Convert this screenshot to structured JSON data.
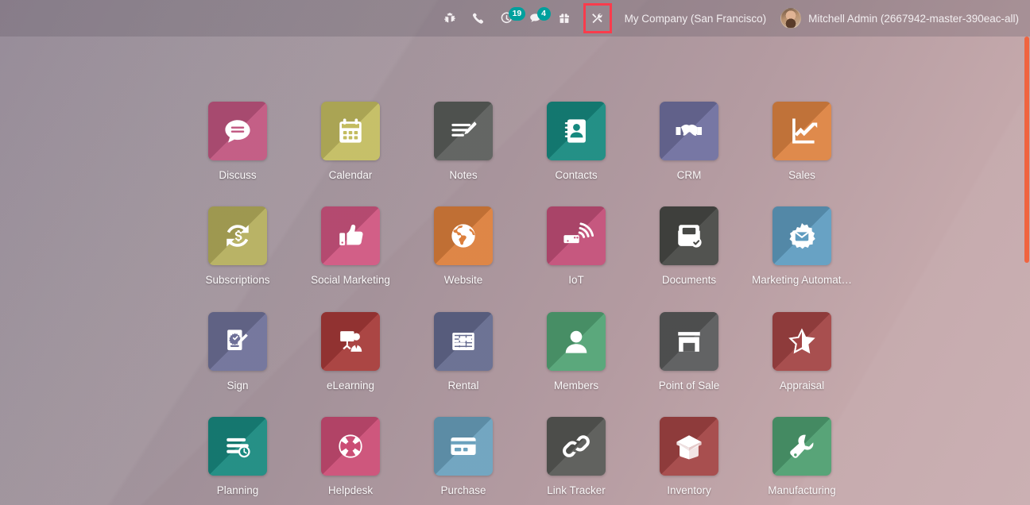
{
  "topbar": {
    "icons": [
      {
        "name": "bug-icon",
        "label": "Bug",
        "badge": null
      },
      {
        "name": "phone-icon",
        "label": "Phone",
        "badge": null
      },
      {
        "name": "activity-clock-icon",
        "label": "Activities",
        "badge": "19"
      },
      {
        "name": "messages-icon",
        "label": "Messages",
        "badge": "4"
      },
      {
        "name": "gift-icon",
        "label": "Gift",
        "badge": null
      },
      {
        "name": "tools-icon",
        "label": "Tools",
        "badge": null,
        "highlighted": true
      }
    ],
    "company": "My Company (San Francisco)",
    "user": "Mitchell Admin (2667942-master-390eac-all)",
    "avatar_name": "avatar",
    "badge_color": "#00a09d",
    "highlight_color": "#fa3c4c"
  },
  "apps": [
    {
      "label": "Discuss",
      "icon": "discuss-icon",
      "color": "#c0557f"
    },
    {
      "label": "Calendar",
      "icon": "calendar-icon",
      "color": "#c3bc60"
    },
    {
      "label": "Notes",
      "icon": "notes-icon",
      "color": "#5a5d5a"
    },
    {
      "label": "Contacts",
      "icon": "contacts-icon",
      "color": "#16897f"
    },
    {
      "label": "CRM",
      "icon": "crm-handshake-icon",
      "color": "#6f6f9e"
    },
    {
      "label": "Sales",
      "icon": "sales-chart-icon",
      "color": "#dd8341"
    },
    {
      "label": "Subscriptions",
      "icon": "subscriptions-icon",
      "color": "#b5ae5c"
    },
    {
      "label": "Social Marketing",
      "icon": "social-marketing-icon",
      "color": "#cf5580"
    },
    {
      "label": "Website",
      "icon": "website-globe-icon",
      "color": "#dc7f3c"
    },
    {
      "label": "IoT",
      "icon": "iot-icon",
      "color": "#c24e77"
    },
    {
      "label": "Documents",
      "icon": "documents-icon",
      "color": "#474845"
    },
    {
      "label": "Marketing Automat…",
      "icon": "marketing-automation-icon",
      "color": "#5f9cc0"
    },
    {
      "label": "Sign",
      "icon": "sign-icon",
      "color": "#6e7098"
    },
    {
      "label": "eLearning",
      "icon": "elearning-icon",
      "color": "#a63a38"
    },
    {
      "label": "Rental",
      "icon": "rental-icon",
      "color": "#646a8e"
    },
    {
      "label": "Members",
      "icon": "members-icon",
      "color": "#51a374"
    },
    {
      "label": "Point of Sale",
      "icon": "point-of-sale-icon",
      "color": "#58595a"
    },
    {
      "label": "Appraisal",
      "icon": "appraisal-star-icon",
      "color": "#a34444"
    },
    {
      "label": "Planning",
      "icon": "planning-icon",
      "color": "#18897f"
    },
    {
      "label": "Helpdesk",
      "icon": "helpdesk-icon",
      "color": "#cb4d75"
    },
    {
      "label": "Purchase",
      "icon": "purchase-card-icon",
      "color": "#6aa1bd"
    },
    {
      "label": "Link Tracker",
      "icon": "link-tracker-icon",
      "color": "#575855"
    },
    {
      "label": "Inventory",
      "icon": "inventory-box-icon",
      "color": "#a34444"
    },
    {
      "label": "Manufacturing",
      "icon": "manufacturing-wrench-icon",
      "color": "#4e9e70"
    }
  ],
  "scrollbar": {
    "name": "page-scrollbar",
    "color": "#f06440"
  }
}
